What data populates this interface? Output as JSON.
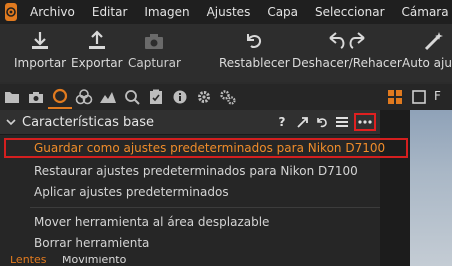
{
  "menubar": {
    "items": [
      "Archivo",
      "Editar",
      "Imagen",
      "Ajustes",
      "Capa",
      "Seleccionar",
      "Cámara"
    ]
  },
  "toolbar": {
    "import_label": "Importar",
    "export_label": "Exportar",
    "capture_label": "Capturar",
    "reset_label": "Restablecer",
    "undo_redo_label": "Deshacer/Rehacer",
    "auto_adjust_label": "Auto ajus"
  },
  "panel": {
    "title": "Características base",
    "help_icon": "?"
  },
  "dropdown": {
    "items": [
      "Guardar como ajustes predeterminados para Nikon D7100",
      "Restaurar ajustes predeterminados para Nikon D7100",
      "Aplicar ajustes predeterminados",
      "Mover herramienta al área desplazable",
      "Borrar herramienta"
    ]
  },
  "bottom_tabs": [
    "Lentes",
    "Movimiento"
  ],
  "colors": {
    "accent": "#e07a1f",
    "highlight_border": "#d41f1f",
    "highlight_text": "#f08c2a"
  }
}
